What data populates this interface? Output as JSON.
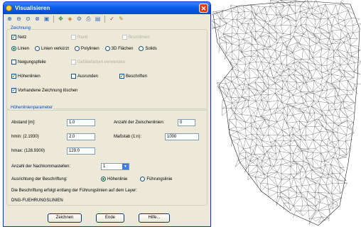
{
  "window": {
    "title": "Visualisieren",
    "close_symbol": "✕"
  },
  "toolbar": {
    "icons": [
      "zoom-in-icon",
      "zoom-out-icon",
      "zoom-window-icon",
      "zoom-all-icon",
      "view-icon",
      "pan-icon",
      "layer-icon",
      "settings-icon",
      "print-icon",
      "save-icon",
      "check-icon",
      "pencil-icon"
    ]
  },
  "zeichnung": {
    "title": "Zeichnung",
    "netz": {
      "label": "Netz",
      "checked": true
    },
    "rand": {
      "label": "Rand",
      "checked": false
    },
    "bruchlinien": {
      "label": "Bruchlinien",
      "checked": false
    },
    "mode_options": [
      "Linien",
      "Linien verkürzt",
      "Polylinien",
      "3D Flächen",
      "Solids"
    ],
    "mode_selected": 0,
    "neigungspfeile": {
      "label": "Neigungspfeile",
      "checked": false
    },
    "gefaelle": {
      "label": "Gefällefarben verwenden",
      "checked": false
    },
    "hoehenlinien": {
      "label": "Höhenlinien",
      "checked": true
    },
    "ausrunden": {
      "label": "Ausrunden",
      "checked": false
    },
    "beschriften": {
      "label": "Beschriften",
      "checked": true
    },
    "loeschen": {
      "label": "Vorhandene Zeichnung löschen",
      "checked": true
    }
  },
  "params": {
    "title": "Höhenlinienparameter",
    "abstand_label": "Abstand [m]:",
    "abstand_value": "1.0",
    "zwischen_label": "Anzahl der Zwischenlinien:",
    "zwischen_value": "0",
    "hmin_label": "hmin: (2.1930)",
    "hmin_value": "2.0",
    "massstab_label": "Maßstab (1:n):",
    "massstab_value": "1000",
    "hmax_label": "hmax: (128.9300)",
    "hmax_value": "129.0",
    "nachkomma_label": "Anzahl der Nachkommastellen:",
    "nachkomma_value": "1",
    "ausrichtung_label": "Ausrichtung der Beschriftung:",
    "ausrichtung_options": [
      "Höhenlinie",
      "Führungslinie"
    ],
    "ausrichtung_selected": 0,
    "info_text": "Die Beschriftung erfolgt entlang der Führungslinien auf dem Layer:",
    "layer_name": "DNG-FUEHRUNGSLINIEN"
  },
  "buttons": {
    "zeichnen": "Zeichnen",
    "ende": "Ende",
    "hilfe": "Hilfe..."
  },
  "colors": {
    "title_blue": "#0a5ee8",
    "check_green": "#21a121",
    "group_title": "#0046d5",
    "dialog_bg": "#ece9d8"
  }
}
